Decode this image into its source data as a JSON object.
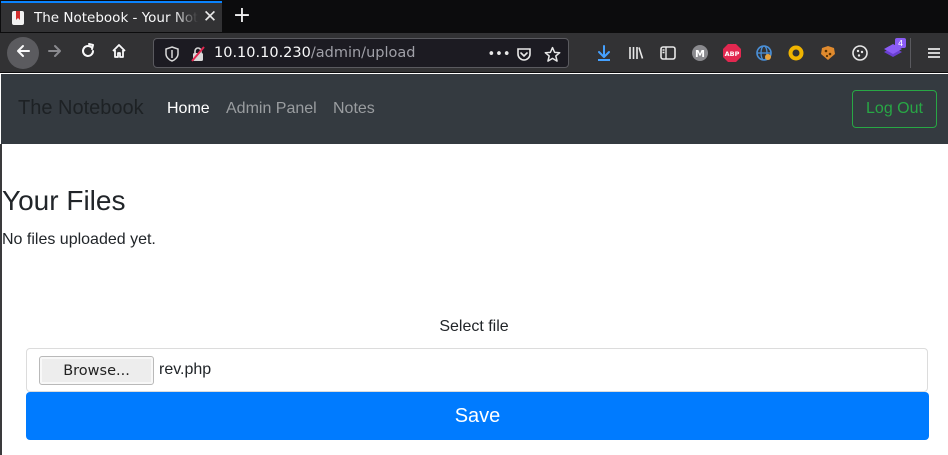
{
  "browser": {
    "tab": {
      "title": "The Notebook - Your Notes",
      "close": "✕",
      "favicon": "notebook-favicon-icon"
    },
    "new_tab": "+",
    "url": {
      "host": "10.10.10.230",
      "path": "/admin/upload"
    },
    "url_more": "•••",
    "extensions": {
      "abp_label": "ABP",
      "badge_count": "4"
    },
    "colors": {
      "tab_accent": "#0a84ff",
      "download_icon": "#45a1ff"
    }
  },
  "site": {
    "brand": "The Notebook",
    "nav": [
      {
        "label": "Home",
        "active": true
      },
      {
        "label": "Admin Panel",
        "active": false
      },
      {
        "label": "Notes",
        "active": false
      }
    ],
    "logout_label": "Log Out",
    "colors": {
      "navbar_bg": "#343a40",
      "logout": "#28a745",
      "primary": "#007bff"
    }
  },
  "page": {
    "files_title": "Your Files",
    "files_empty": "No files uploaded yet.",
    "upload": {
      "label": "Select file",
      "browse_label": "Browse...",
      "selected_file": "rev.php",
      "save_label": "Save"
    }
  }
}
